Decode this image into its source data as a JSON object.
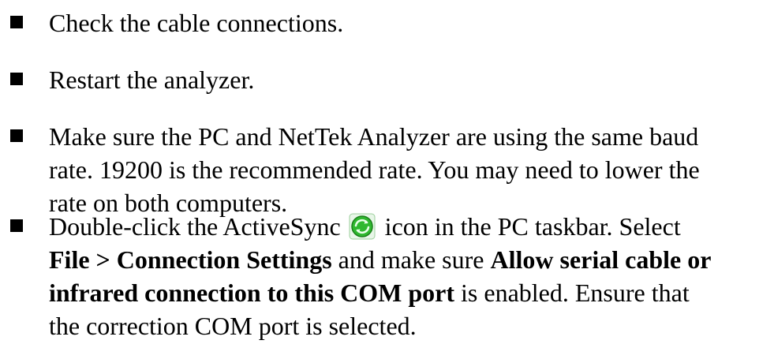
{
  "bullets": [
    {
      "text": "Check the cable connections."
    },
    {
      "text": "Restart the analyzer."
    },
    {
      "line1": "Make sure the PC and NetTek Analyzer are using the same baud",
      "line2": "rate. 19200 is the recommended rate. You may need to lower the",
      "line3": "rate on both computers."
    },
    {
      "part1": "Double-click the ActiveSync",
      "part2": "icon in the PC taskbar. Select",
      "bold1": "File > Connection Settings",
      "part3": "and make sure",
      "bold2": "Allow serial cable or",
      "bold3": "infrared connection to this COM port",
      "part4": "is enabled. Ensure that",
      "part5": "the correction COM port is selected.",
      "icon": "activesync-icon"
    }
  ],
  "colors": {
    "text": "#000000",
    "icon_green": "#2fb82f",
    "icon_light": "#8de88d"
  }
}
